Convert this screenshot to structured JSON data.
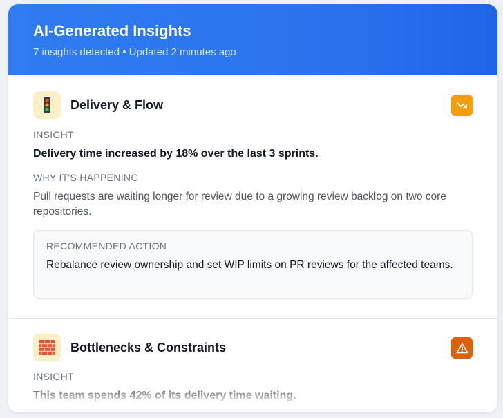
{
  "header": {
    "title": "AI-Generated Insights",
    "subtitle": "7 insights detected • Updated 2 minutes ago"
  },
  "insights": [
    {
      "icon": "traffic-light-icon",
      "category": "Delivery & Flow",
      "status_icon": "trend-down-icon",
      "status_color": "#f59e0b",
      "insight_label": "INSIGHT",
      "insight": "Delivery time increased by 18% over the last 3 sprints.",
      "why_label": "WHY IT'S HAPPENING",
      "why": "Pull requests are waiting longer for review due to a growing review backlog on two core repositories.",
      "action_label": "RECOMMENDED ACTION",
      "action": "Rebalance review ownership and set WIP limits on PR reviews for the affected teams."
    },
    {
      "icon": "brick-wall-icon",
      "category": "Bottlenecks & Constraints",
      "status_icon": "warning-icon",
      "status_color": "#d9620b",
      "insight_label": "INSIGHT",
      "insight": "This team spends 42% of its delivery time waiting."
    }
  ]
}
